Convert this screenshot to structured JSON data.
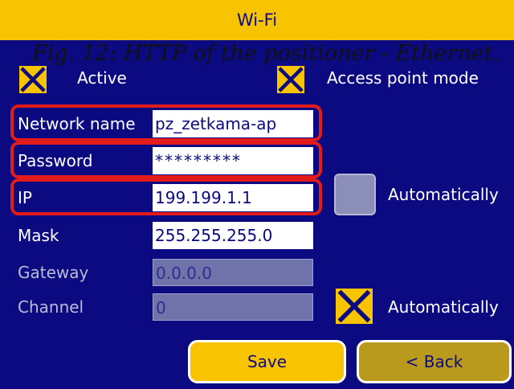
{
  "window": {
    "title": "Wi-Fi"
  },
  "caption": "Fig. 12: HTTP of the positioner - Ethernet.",
  "toggles": {
    "active": {
      "label": "Active",
      "checked": true
    },
    "access_point_mode": {
      "label": "Access point mode",
      "checked": true
    }
  },
  "fields": {
    "network_name": {
      "label": "Network name",
      "value": "pz_zetkama-ap"
    },
    "password": {
      "label": "Password",
      "value": "*********"
    },
    "ip": {
      "label": "IP",
      "value": "199.199.1.1"
    },
    "mask": {
      "label": "Mask",
      "value": "255.255.255.0"
    },
    "gateway": {
      "label": "Gateway",
      "value": "0.0.0.0",
      "disabled": true
    },
    "channel": {
      "label": "Channel",
      "value": "0",
      "disabled": true
    }
  },
  "auto_ip": {
    "label": "Automatically",
    "checked": false
  },
  "auto_channel": {
    "label": "Automatically",
    "checked": true
  },
  "buttons": {
    "save": "Save",
    "back": "< Back"
  },
  "colors": {
    "background": "#0c0a80",
    "accent": "#f8c300",
    "highlight": "#e21b1b",
    "back_button": "#b99a1c"
  }
}
